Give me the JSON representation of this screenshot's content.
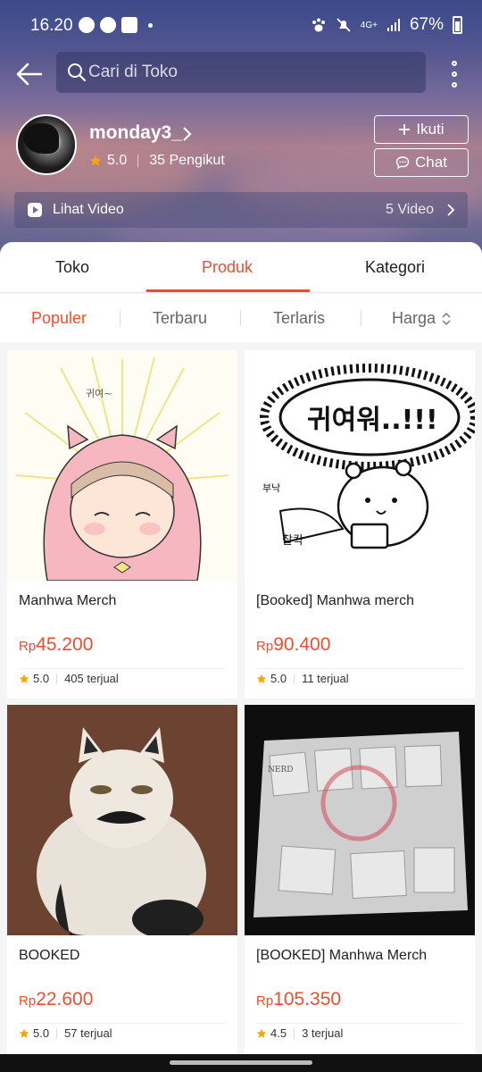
{
  "status_bar": {
    "time": "16.20",
    "network": "4G+",
    "battery": "67%"
  },
  "header": {
    "search_placeholder": "Cari di Toko"
  },
  "shop": {
    "name": "monday3_",
    "rating": "5.0",
    "followers": "35 Pengikut",
    "follow_label": "Ikuti",
    "chat_label": "Chat"
  },
  "video_bar": {
    "label": "Lihat Video",
    "count": "5 Video"
  },
  "tabs": [
    {
      "label": "Toko"
    },
    {
      "label": "Produk"
    },
    {
      "label": "Kategori"
    }
  ],
  "sort": [
    {
      "label": "Populer"
    },
    {
      "label": "Terbaru"
    },
    {
      "label": "Terlaris"
    },
    {
      "label": "Harga"
    }
  ],
  "products": [
    {
      "name": "Manhwa Merch",
      "currency": "Rp",
      "price": "45.200",
      "rating": "5.0",
      "sold": "405 terjual",
      "art_text": "귀여~"
    },
    {
      "name": "[Booked] Manhwa merch",
      "currency": "Rp",
      "price": "90.400",
      "rating": "5.0",
      "sold": "11 terjual",
      "art_text": "귀여워..!!!",
      "art_text2": "찰칵",
      "art_text3": "부낙"
    },
    {
      "name": "BOOKED",
      "currency": "Rp",
      "price": "22.600",
      "rating": "5.0",
      "sold": "57 terjual"
    },
    {
      "name": "[BOOKED] Manhwa Merch",
      "currency": "Rp",
      "price": "105.350",
      "rating": "4.5",
      "sold": "3 terjual",
      "art_text": "NERD"
    }
  ],
  "colors": {
    "accent": "#ee4d2d",
    "star": "#f6a700"
  }
}
